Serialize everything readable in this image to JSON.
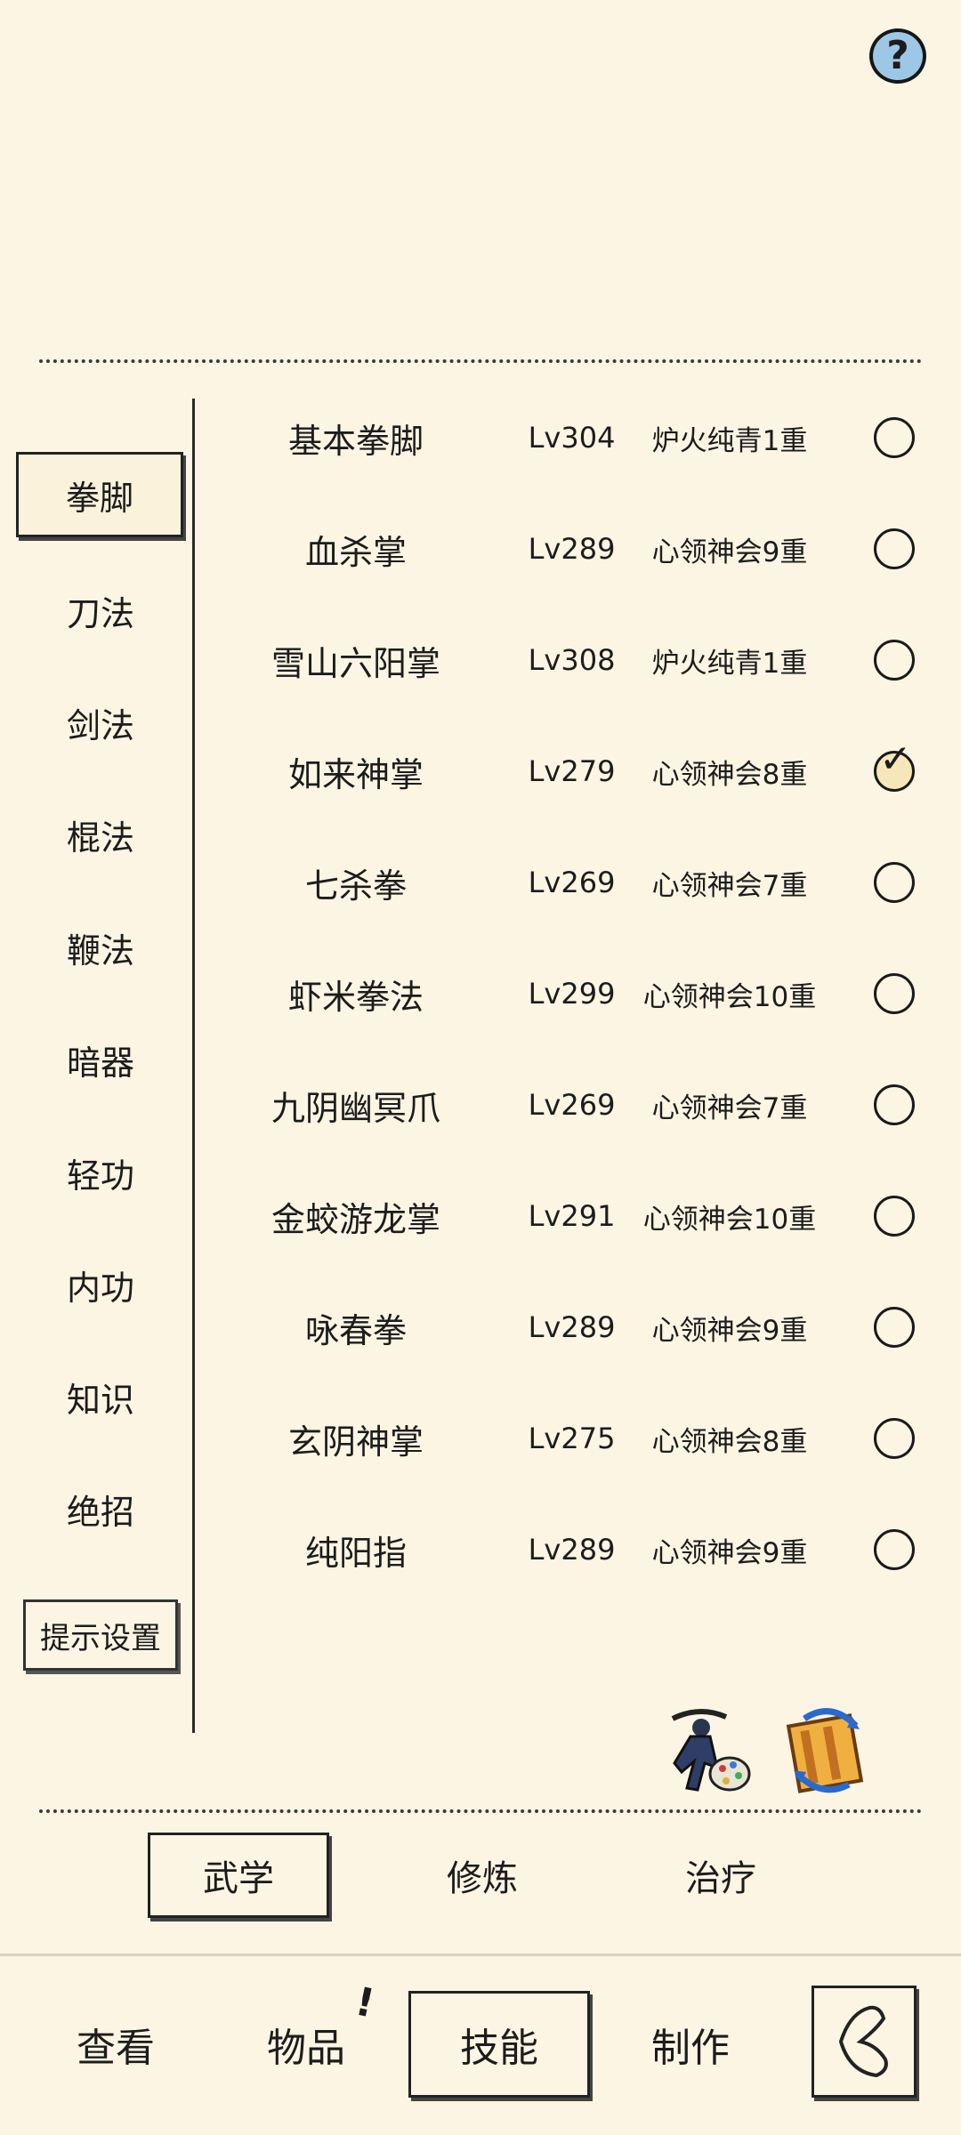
{
  "top": {
    "help_icon": "question-circle-icon",
    "help_label": "?"
  },
  "categories": [
    {
      "label": "拳脚",
      "active": true
    },
    {
      "label": "刀法"
    },
    {
      "label": "剑法"
    },
    {
      "label": "棍法"
    },
    {
      "label": "鞭法"
    },
    {
      "label": "暗器"
    },
    {
      "label": "轻功"
    },
    {
      "label": "内功"
    },
    {
      "label": "知识"
    },
    {
      "label": "绝招"
    }
  ],
  "hint_settings_label": "提示设置",
  "skills": [
    {
      "name": "基本拳脚",
      "level": "Lv304",
      "tier": "炉火纯青1重",
      "selected": false
    },
    {
      "name": "血杀掌",
      "level": "Lv289",
      "tier": "心领神会9重",
      "selected": false
    },
    {
      "name": "雪山六阳掌",
      "level": "Lv308",
      "tier": "炉火纯青1重",
      "selected": false
    },
    {
      "name": "如来神掌",
      "level": "Lv279",
      "tier": "心领神会8重",
      "selected": true
    },
    {
      "name": "七杀拳",
      "level": "Lv269",
      "tier": "心领神会7重",
      "selected": false
    },
    {
      "name": "虾米拳法",
      "level": "Lv299",
      "tier": "心领神会10重",
      "selected": false
    },
    {
      "name": "九阴幽冥爪",
      "level": "Lv269",
      "tier": "心领神会7重",
      "selected": false
    },
    {
      "name": "金蛟游龙掌",
      "level": "Lv291",
      "tier": "心领神会10重",
      "selected": false
    },
    {
      "name": "咏春拳",
      "level": "Lv289",
      "tier": "心领神会9重",
      "selected": false
    },
    {
      "name": "玄阴神掌",
      "level": "Lv275",
      "tier": "心领神会8重",
      "selected": false
    },
    {
      "name": "纯阳指",
      "level": "Lv289",
      "tier": "心领神会9重",
      "selected": false
    }
  ],
  "tools": {
    "left_icon": "martial-artist-palette-icon",
    "right_icon": "scroll-swap-icon"
  },
  "subtabs": [
    {
      "label": "武学",
      "active": true
    },
    {
      "label": "修炼"
    },
    {
      "label": "治疗"
    }
  ],
  "bottom_nav": [
    {
      "label": "查看"
    },
    {
      "label": "物品",
      "badge": "!"
    },
    {
      "label": "技能",
      "active": true
    },
    {
      "label": "制作"
    }
  ],
  "back_icon": "back-arrow-icon"
}
